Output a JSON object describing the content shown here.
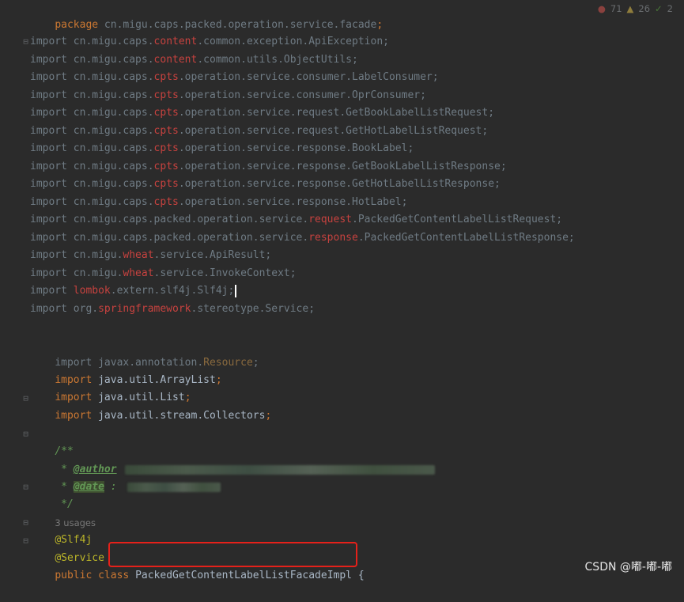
{
  "editor": {
    "package_line": {
      "kw": "package",
      "path": " cn.migu.caps.packed.operation.service.facade",
      "semi": ";"
    },
    "inspections": {
      "errors": "71",
      "warnings": "26",
      "typos": "2"
    },
    "imports": [
      {
        "pre": "import cn.migu.caps.",
        "hl": "content",
        "post": ".common.exception.ApiException;"
      },
      {
        "pre": "import cn.migu.caps.",
        "hl": "content",
        "post": ".common.utils.ObjectUtils;"
      },
      {
        "pre": "import cn.migu.caps.",
        "hl": "cpts",
        "post": ".operation.service.consumer.LabelConsumer;"
      },
      {
        "pre": "import cn.migu.caps.",
        "hl": "cpts",
        "post": ".operation.service.consumer.OprConsumer;"
      },
      {
        "pre": "import cn.migu.caps.",
        "hl": "cpts",
        "post": ".operation.service.request.GetBookLabelListRequest;"
      },
      {
        "pre": "import cn.migu.caps.",
        "hl": "cpts",
        "post": ".operation.service.request.GetHotLabelListRequest;"
      },
      {
        "pre": "import cn.migu.caps.",
        "hl": "cpts",
        "post": ".operation.service.response.BookLabel;"
      },
      {
        "pre": "import cn.migu.caps.",
        "hl": "cpts",
        "post": ".operation.service.response.GetBookLabelListResponse;"
      },
      {
        "pre": "import cn.migu.caps.",
        "hl": "cpts",
        "post": ".operation.service.response.GetHotLabelListResponse;"
      },
      {
        "pre": "import cn.migu.caps.",
        "hl": "cpts",
        "post": ".operation.service.response.HotLabel;"
      },
      {
        "pre": "import cn.migu.caps.packed.operation.service.",
        "hl": "request",
        "post": ".PackedGetContentLabelListRequest;"
      },
      {
        "pre": "import cn.migu.caps.packed.operation.service.",
        "hl": "response",
        "post": ".PackedGetContentLabelListResponse;"
      },
      {
        "pre": "import cn.migu.",
        "hl": "wheat",
        "post": ".service.ApiResult;"
      },
      {
        "pre": "import cn.migu.",
        "hl": "wheat",
        "post": ".service.InvokeContext;"
      },
      {
        "pre": "import ",
        "hl": "lombok",
        "post": ".extern.slf4j.Slf4j;"
      },
      {
        "pre": "import org.",
        "hl": "springframework",
        "post": ".stereotype.Service;"
      }
    ],
    "imports2": {
      "resource": {
        "pre": "import javax.annotation.",
        "hl": "Resource",
        "post": ";"
      },
      "arraylist": {
        "kw": "import",
        "body": " java.util.ArrayList",
        "semi": ";"
      },
      "list": {
        "kw": "import",
        "body": " java.util.List",
        "semi": ";"
      },
      "collectors": {
        "kw": "import",
        "body": " java.util.stream.Collectors",
        "semi": ";"
      }
    },
    "javadoc": {
      "open": "/**",
      "star": " * ",
      "author_tag": "@author",
      "date_tag": "@date",
      "date_sep": " : ",
      "close": " */"
    },
    "usages": "3 usages",
    "annotations": {
      "slf4j": "@Slf4j",
      "service": "@Service"
    },
    "class_line": {
      "kw1": "public",
      "kw2": " class ",
      "name": "PackedGetContentLabelListFacadeImpl",
      "brace": " {"
    }
  },
  "watermark": "CSDN @嘟-嘟-嘟",
  "colors": {
    "background": "#2b2b2b",
    "keyword": "#cc7832",
    "text": "#a9b7c6",
    "annotation": "#bbb529",
    "doc": "#629755",
    "highlight_box": "#e5211a"
  }
}
